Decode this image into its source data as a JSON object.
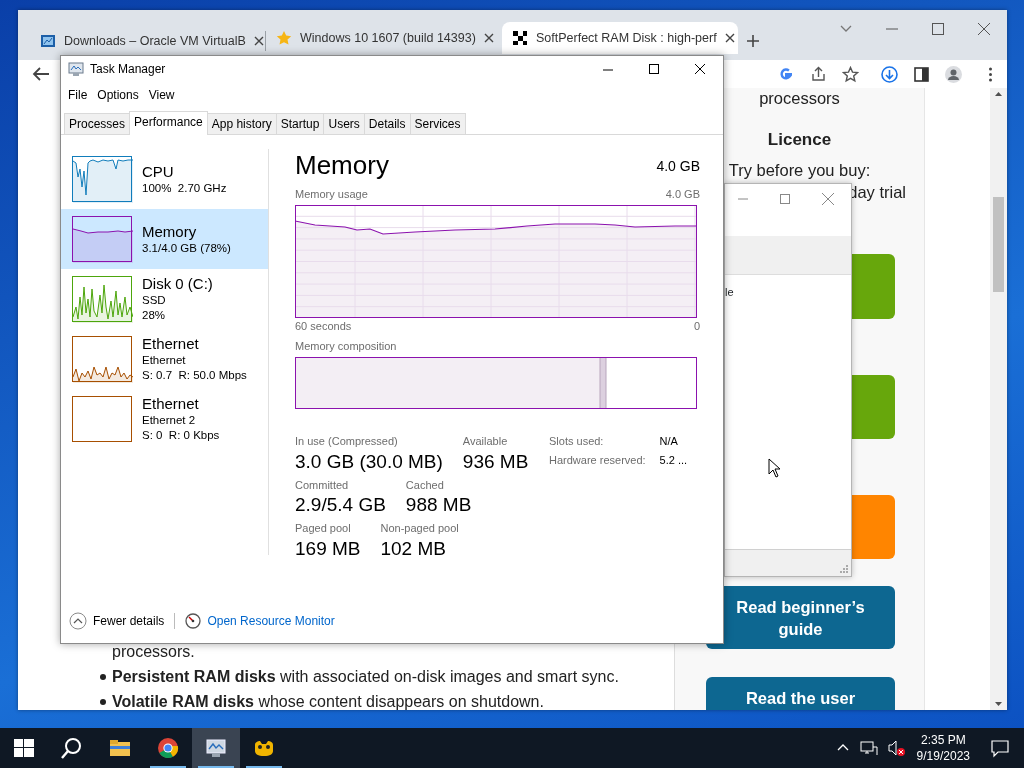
{
  "browser": {
    "tabs": [
      {
        "title": "Downloads – Oracle VM VirtualB",
        "kind": "boxes",
        "selected": false
      },
      {
        "title": "Windows 10 1607 (build 14393)",
        "kind": "star",
        "selected": false
      },
      {
        "title": "SoftPerfect RAM Disk : high-perf",
        "kind": "checker",
        "selected": true
      }
    ],
    "page": {
      "main": {
        "tail": "processors.",
        "bullets": [
          {
            "text": "**Persistent RAM disks** with associated on-disk images and smart sync."
          },
          {
            "text": "**Volatile RAM disks** whose content disappears on shutdown."
          }
        ]
      },
      "sidebar": {
        "top_text": "processors",
        "heading": "Licence",
        "trial_text": "Try before you buy:",
        "trial_fragment": "day trial",
        "buttons": [
          {
            "color": "#67a70c"
          },
          {
            "color": "#67a70c"
          },
          {
            "color": "#ff8500"
          },
          {
            "label": "Read beginner’s guide",
            "color": "#0d6791"
          },
          {
            "label": "Read the user",
            "color": "#0d6791"
          }
        ]
      }
    }
  },
  "small_window": {
    "list_text": "le"
  },
  "task_manager": {
    "title": "Task Manager",
    "menu": [
      "File",
      "Options",
      "View"
    ],
    "tabs": [
      {
        "label": "Processes",
        "selected": false
      },
      {
        "label": "Performance",
        "selected": true
      },
      {
        "label": "App history",
        "selected": false
      },
      {
        "label": "Startup",
        "selected": false
      },
      {
        "label": "Users",
        "selected": false
      },
      {
        "label": "Details",
        "selected": false
      },
      {
        "label": "Services",
        "selected": false
      }
    ],
    "resources": [
      {
        "name": "CPU",
        "details": [
          "100%  2.70 GHz"
        ],
        "kind": "cpu",
        "color": "#117dbb",
        "selected": false
      },
      {
        "name": "Memory",
        "details": [
          "3.1/4.0 GB (78%)"
        ],
        "kind": "memory",
        "color": "#8b12ae",
        "selected": true
      },
      {
        "name": "Disk 0 (C:)",
        "details": [
          "SSD",
          "28%"
        ],
        "kind": "disk",
        "color": "#4da60c",
        "selected": false
      },
      {
        "name": "Ethernet",
        "details": [
          "Ethernet",
          "S: 0.7  R: 50.0 Mbps"
        ],
        "kind": "net",
        "color": "#a74f01",
        "selected": false
      },
      {
        "name": "Ethernet",
        "details": [
          "Ethernet 2",
          "S: 0  R: 0 Kbps"
        ],
        "kind": "idle",
        "color": "#a74f01",
        "selected": false
      }
    ],
    "panel": {
      "title": "Memory",
      "total": "4.0 GB",
      "usage_label": "Memory usage",
      "usage_max": "4.0 GB",
      "time_label": "60 seconds",
      "time_end": "0",
      "composition_label": "Memory composition",
      "stat_rows": [
        {
          "items": [
            {
              "label": "In use (Compressed)",
              "value": "3.0 GB (30.0 MB)"
            },
            {
              "label": "Available",
              "value": "936 MB"
            }
          ]
        },
        {
          "items": [
            {
              "label": "Committed",
              "value": "2.9/5.4 GB"
            },
            {
              "label": "Cached",
              "value": "988 MB"
            }
          ]
        },
        {
          "items": [
            {
              "label": "Paged pool",
              "value": "169 MB"
            },
            {
              "label": "Non-paged pool",
              "value": "102 MB"
            }
          ]
        }
      ],
      "hardware": [
        {
          "label": "Slots used:",
          "value": "N/A"
        },
        {
          "label": "Hardware reserved:",
          "value": "5.2 ..."
        }
      ]
    },
    "footer": {
      "fewer": "Fewer details",
      "monitor_link": "Open Resource Monitor"
    }
  },
  "taskbar": {
    "apps": [
      {
        "kind": "folder",
        "running": false,
        "selected": false
      },
      {
        "kind": "chrome",
        "running": true,
        "selected": false
      },
      {
        "kind": "taskmgr",
        "running": true,
        "selected": true
      },
      {
        "kind": "app",
        "running": true,
        "selected": false
      }
    ],
    "time": "2:35 PM",
    "date": "9/19/2023"
  }
}
